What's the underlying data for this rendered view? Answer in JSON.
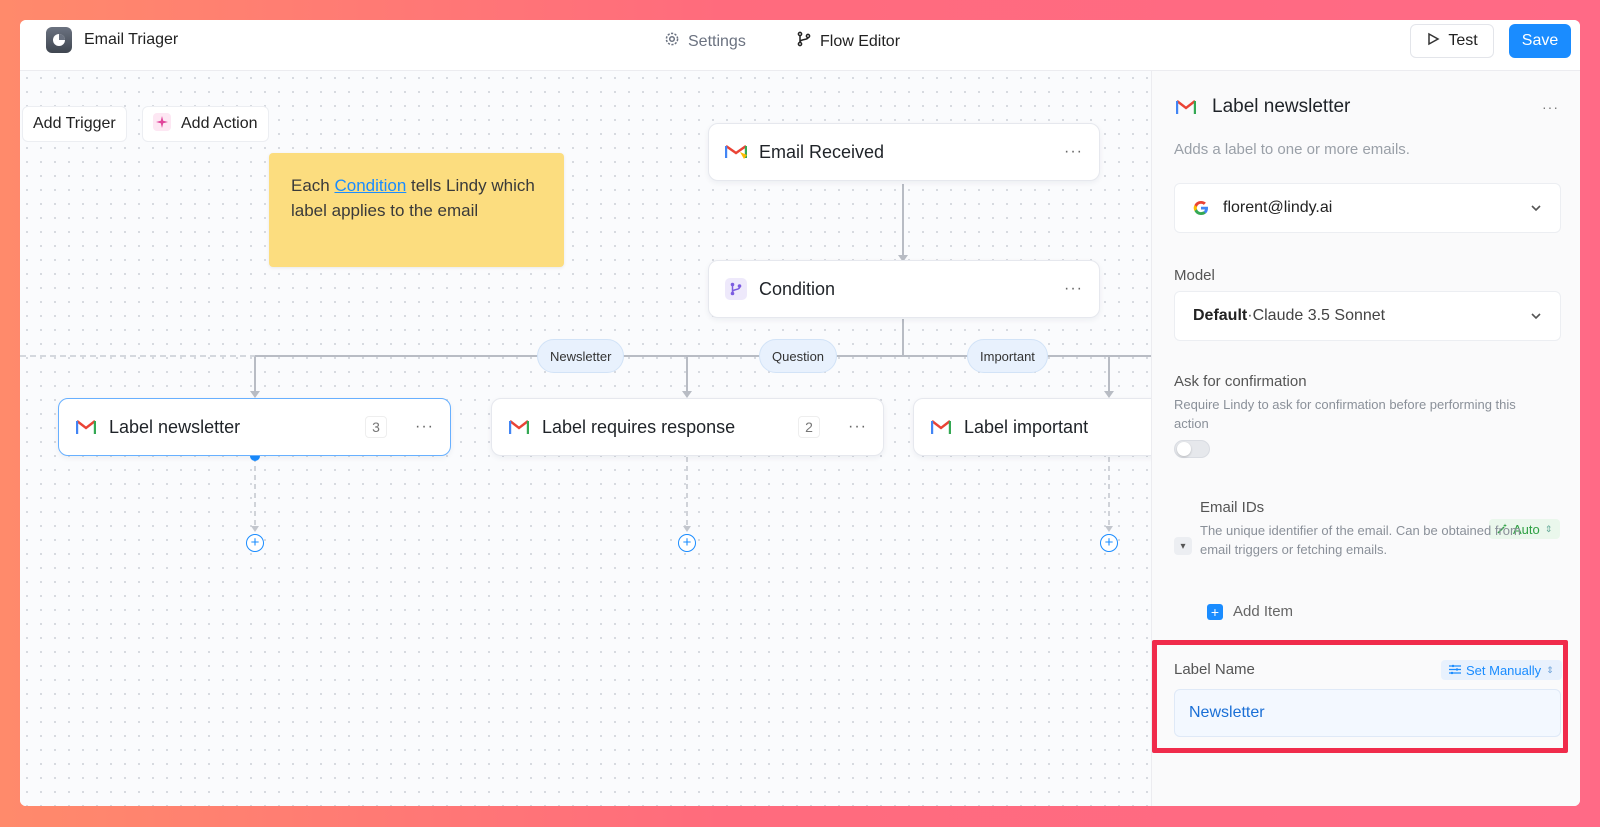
{
  "app": {
    "title": "Email Triager"
  },
  "nav": {
    "settings": "Settings",
    "flow_editor": "Flow Editor",
    "test": "Test",
    "save": "Save"
  },
  "toolbar": {
    "add_trigger": "Add Trigger",
    "add_action": "Add Action"
  },
  "note": {
    "before": "Each ",
    "link": "Condition",
    "after": " tells Lindy which label applies to the email"
  },
  "nodes": {
    "email_received": {
      "label": "Email Received"
    },
    "condition": {
      "label": "Condition"
    },
    "label_newsletter": {
      "label": "Label newsletter",
      "count": "3"
    },
    "label_requires_response": {
      "label": "Label requires response",
      "count": "2"
    },
    "label_important": {
      "label": "Label important"
    }
  },
  "branches": [
    "Newsletter",
    "Question",
    "Important"
  ],
  "panel": {
    "title": "Label newsletter",
    "description": "Adds a label to one or more emails.",
    "account": "florent@lindy.ai",
    "model_label": "Model",
    "model_default": "Default",
    "model_sep": " · ",
    "model_name": "Claude 3.5 Sonnet",
    "confirm_label": "Ask for confirmation",
    "confirm_help": "Require Lindy to ask for confirmation before performing this action",
    "confirm_on": false,
    "email_ids_label": "Email IDs",
    "email_ids_mode": "Auto",
    "email_ids_help": "The unique identifier of the email. Can be obtained from email triggers or fetching emails.",
    "add_item": "Add Item",
    "label_name_label": "Label Name",
    "label_name_mode": "Set Manually",
    "label_name_value": "Newsletter"
  },
  "colors": {
    "accent": "#1a8cff",
    "highlight": "#f02b4b",
    "note": "#fcdd7f"
  },
  "icons": [
    "app-logo-icon",
    "gear-icon",
    "branch-icon",
    "play-icon",
    "sparkle-icon",
    "gmail-icon",
    "condition-icon",
    "google-icon",
    "chevron-down-icon",
    "wand-icon",
    "plus-icon"
  ]
}
